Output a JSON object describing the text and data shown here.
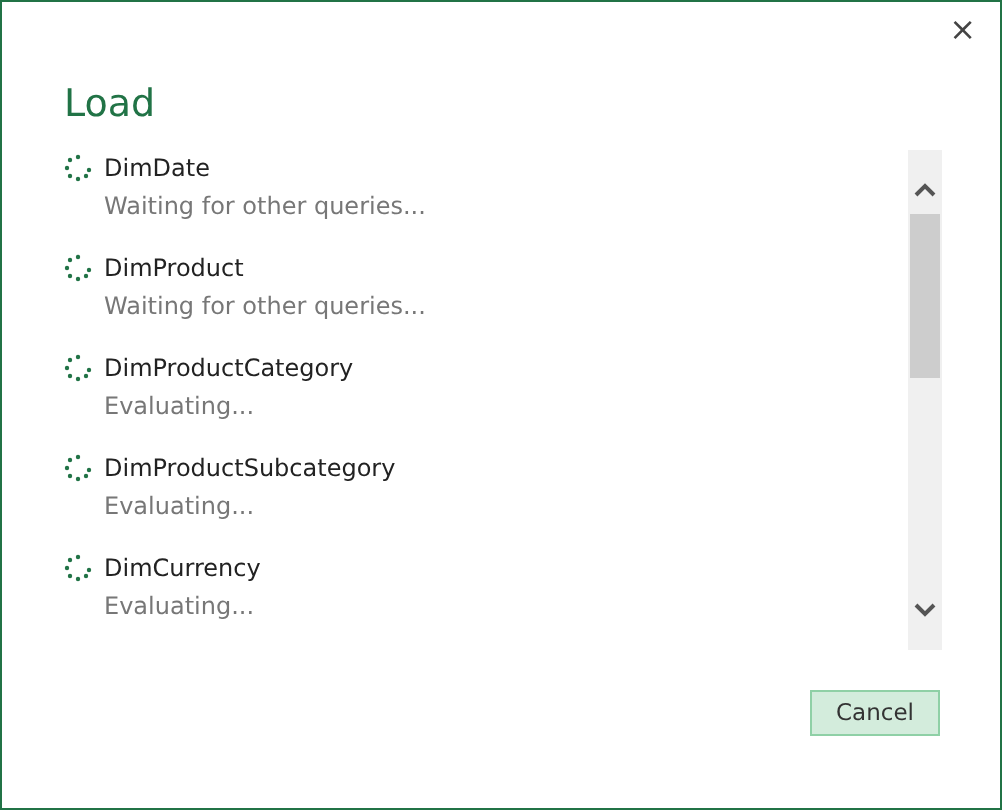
{
  "window": {
    "close": "×",
    "title": "Load"
  },
  "queries": [
    {
      "name": "DimDate",
      "status": "Waiting for other queries..."
    },
    {
      "name": "DimProduct",
      "status": "Waiting for other queries..."
    },
    {
      "name": "DimProductCategory",
      "status": "Evaluating..."
    },
    {
      "name": "DimProductSubcategory",
      "status": "Evaluating..."
    },
    {
      "name": "DimCurrency",
      "status": "Evaluating..."
    }
  ],
  "buttons": [
    "Cancel"
  ]
}
